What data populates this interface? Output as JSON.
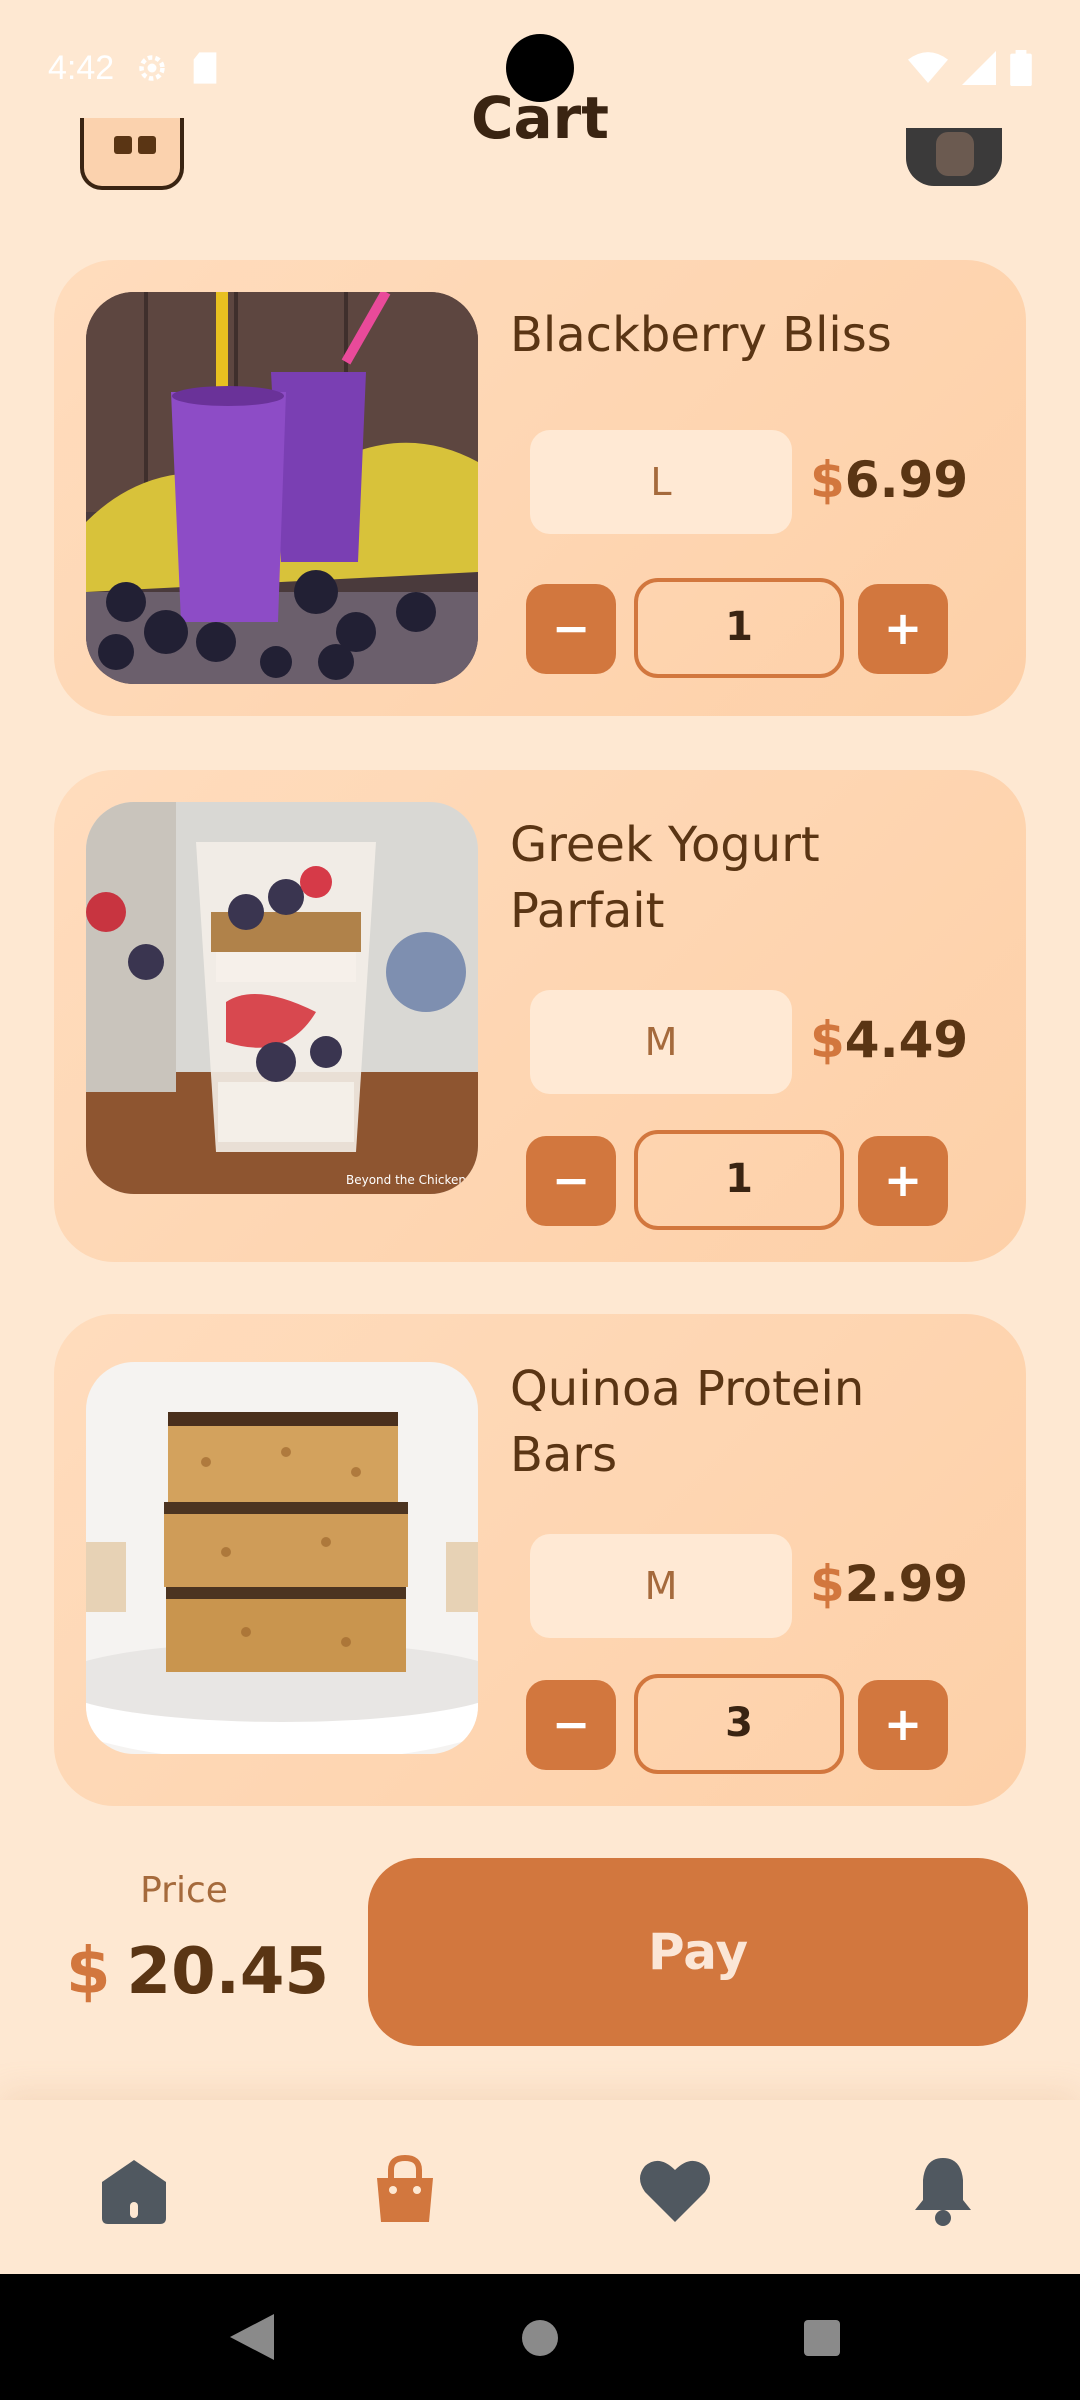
{
  "status_bar": {
    "time": "4:42"
  },
  "header": {
    "title": "Cart"
  },
  "cart_items": [
    {
      "name": "Blackberry Bliss",
      "size": "L",
      "currency": "$",
      "price": "6.99",
      "quantity": "1"
    },
    {
      "name": "Greek Yogurt Parfait",
      "size": "M",
      "currency": "$",
      "price": "4.49",
      "quantity": "1"
    },
    {
      "name": "Quinoa Protein Bars",
      "size": "M",
      "currency": "$",
      "price": "2.99",
      "quantity": "3"
    }
  ],
  "image_credit": "Beyond the Chicken C",
  "qty_controls": {
    "minus": "−",
    "plus": "+"
  },
  "total": {
    "label": "Price",
    "currency": "$",
    "value": "20.45"
  },
  "pay_button": {
    "label": "Pay"
  },
  "bottom_nav": {
    "items": [
      {
        "icon": "home-icon",
        "active": false
      },
      {
        "icon": "shopping-bag-icon",
        "active": true
      },
      {
        "icon": "heart-icon",
        "active": false
      },
      {
        "icon": "bell-icon",
        "active": false
      }
    ]
  },
  "colors": {
    "accent": "#d2773e",
    "background": "#fee8d2",
    "text_dark": "#5a3514",
    "nav_inactive": "#505860"
  }
}
